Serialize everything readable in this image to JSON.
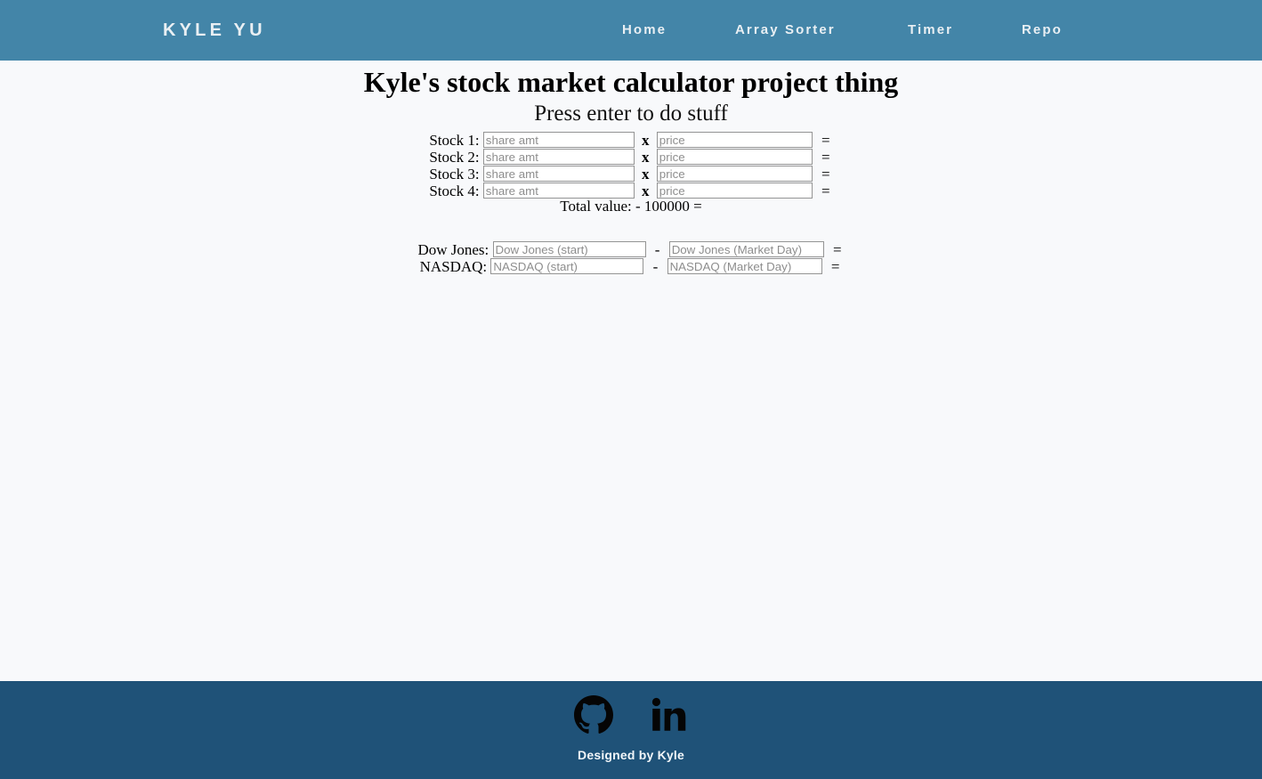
{
  "navbar": {
    "brand": "KYLE YU",
    "background_color": "#4385a8",
    "text_color": "#e9eff3",
    "links": [
      {
        "label": "Home"
      },
      {
        "label": "Array Sorter"
      },
      {
        "label": "Timer"
      },
      {
        "label": "Repo"
      }
    ]
  },
  "main": {
    "title": "Kyle's stock market calculator project thing",
    "subtitle": "Press enter to do stuff",
    "stock_rows": [
      {
        "label": "Stock 1:",
        "amount_placeholder": "share amt",
        "amount_value": "",
        "operator": "x",
        "price_placeholder": "price",
        "price_value": "",
        "equals": "="
      },
      {
        "label": "Stock 2:",
        "amount_placeholder": "share amt",
        "amount_value": "",
        "operator": "x",
        "price_placeholder": "price",
        "price_value": "",
        "equals": "="
      },
      {
        "label": "Stock 3:",
        "amount_placeholder": "share amt",
        "amount_value": "",
        "operator": "x",
        "price_placeholder": "price",
        "price_value": "",
        "equals": "="
      },
      {
        "label": "Stock 4:",
        "amount_placeholder": "share amt",
        "amount_value": "",
        "operator": "x",
        "price_placeholder": "price",
        "price_value": "",
        "equals": "="
      }
    ],
    "total_line": "Total value: - 100000 =",
    "index_rows": [
      {
        "label": "Dow Jones:",
        "start_placeholder": "Dow Jones (start)",
        "start_value": "",
        "operator": "-",
        "market_placeholder": "Dow Jones (Market Day)",
        "market_value": "",
        "equals": "="
      },
      {
        "label": "NASDAQ:",
        "start_placeholder": "NASDAQ (start)",
        "start_value": "",
        "operator": "-",
        "market_placeholder": "NASDAQ (Market Day)",
        "market_value": "",
        "equals": "="
      }
    ]
  },
  "footer": {
    "background_color": "#1f5278",
    "icons": [
      {
        "name": "github-icon"
      },
      {
        "name": "linkedin-icon"
      }
    ],
    "note": "Designed by Kyle"
  }
}
